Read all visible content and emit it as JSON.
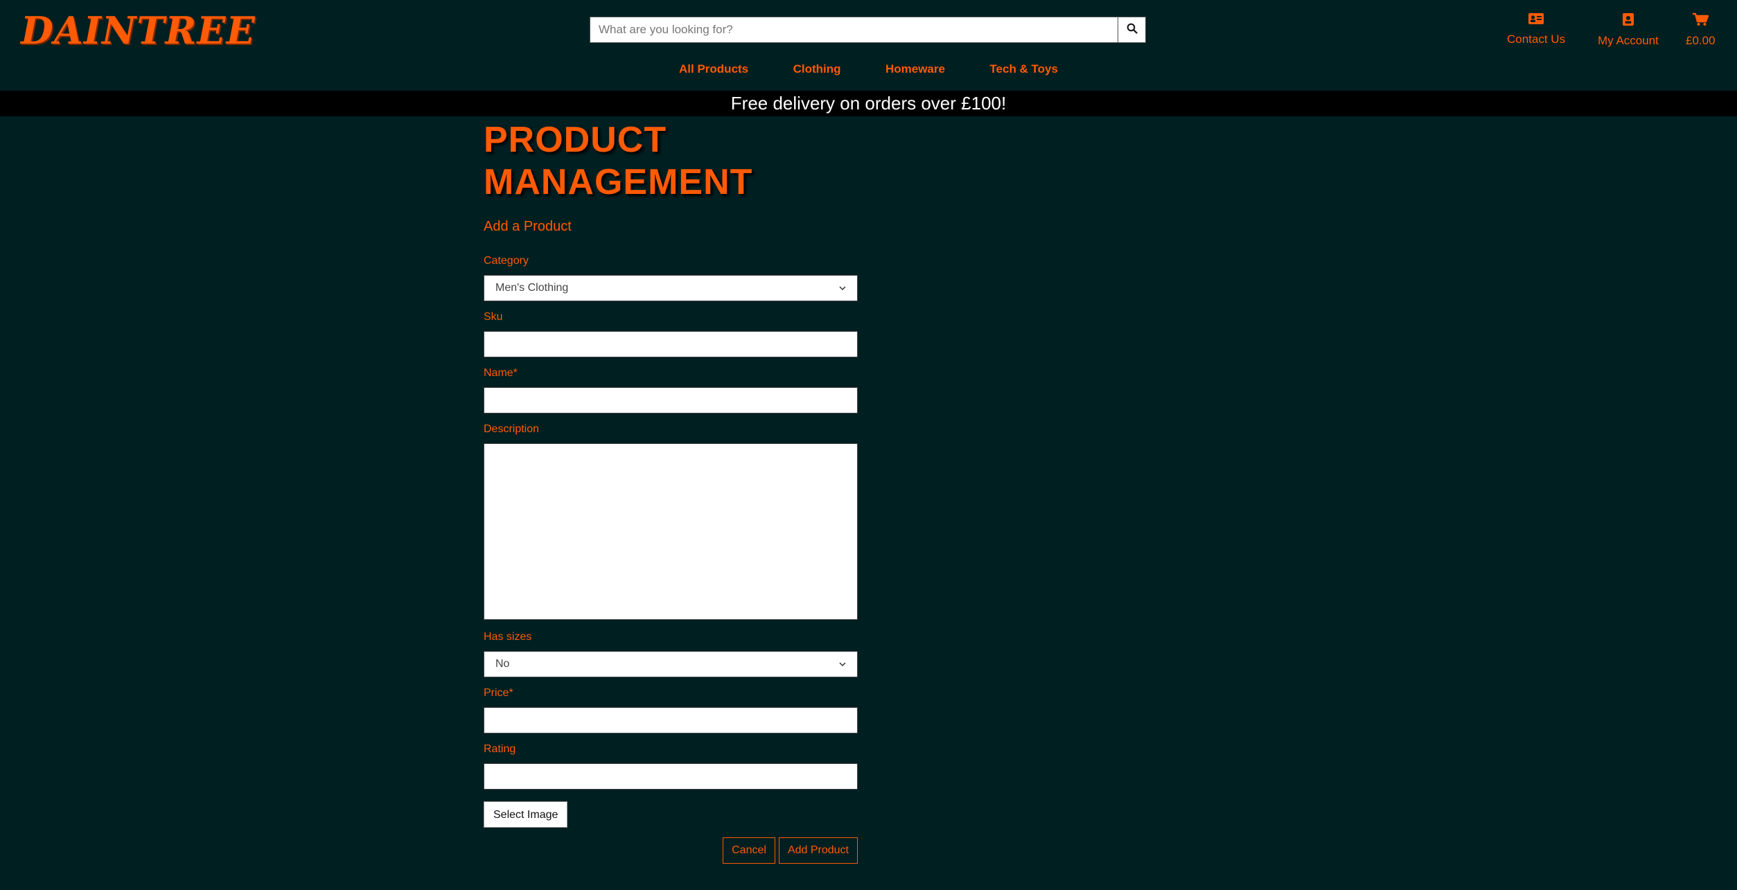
{
  "brand": {
    "logo": "DAINTREE"
  },
  "search": {
    "placeholder": "What are you looking for?",
    "icon": "search-icon"
  },
  "header_links": [
    {
      "label": "Contact Us",
      "icon": "id-card-icon"
    },
    {
      "label": "My Account",
      "icon": "user-badge-icon"
    },
    {
      "label": "£0.00",
      "icon": "cart-icon"
    }
  ],
  "nav": [
    "All Products",
    "Clothing",
    "Homeware",
    "Tech & Toys"
  ],
  "banner": "Free delivery on orders over £100!",
  "page": {
    "title_line1": "PRODUCT",
    "title_line2": "MANAGEMENT",
    "subtitle": "Add a Product"
  },
  "form": {
    "category_label": "Category",
    "category_value": "Men's Clothing",
    "sku_label": "Sku",
    "sku_value": "",
    "name_label": "Name*",
    "name_value": "",
    "description_label": "Description",
    "description_value": "",
    "has_sizes_label": "Has sizes",
    "has_sizes_value": "No",
    "price_label": "Price*",
    "price_value": "",
    "rating_label": "Rating",
    "rating_value": "",
    "select_image": "Select Image",
    "cancel": "Cancel",
    "submit": "Add Product"
  },
  "colors": {
    "accent": "#ff5a05",
    "background": "#001f21",
    "banner": "#000000"
  }
}
